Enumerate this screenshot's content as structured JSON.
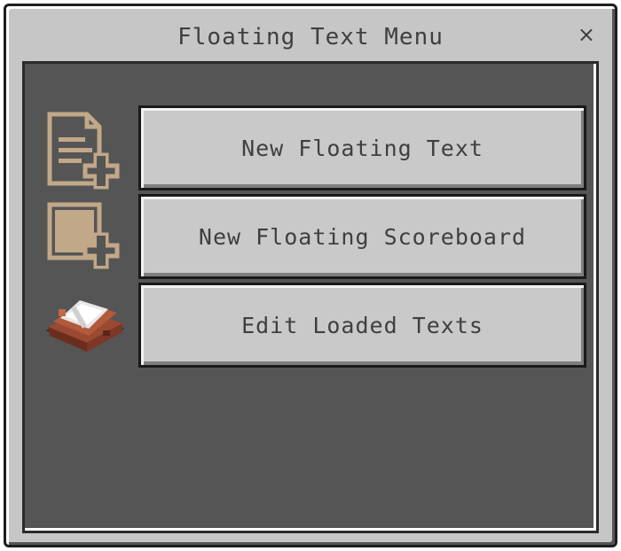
{
  "window": {
    "title": "Floating Text Menu",
    "close_label": "×"
  },
  "menu": {
    "items": [
      {
        "label": "New Floating Text",
        "icon": "new-document-icon"
      },
      {
        "label": "New Floating Scoreboard",
        "icon": "new-scoreboard-icon"
      },
      {
        "label": "Edit Loaded Texts",
        "icon": "book-icon"
      }
    ]
  },
  "colors": {
    "dialog_bg": "#c6c6c6",
    "panel_bg": "#555555",
    "button_bg": "#c9c9c9",
    "icon_tan": "#c1a888",
    "text": "#3f3f3f"
  }
}
